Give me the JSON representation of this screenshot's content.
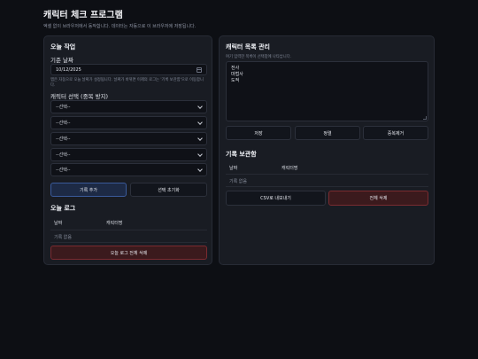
{
  "header": {
    "title": "캐릭터 체크 프로그램",
    "subtitle": "엑셀 없이 브라우저에서 동작합니다. 데이터는 자동으로 이 브라우저에 저장됩니다."
  },
  "today": {
    "section_title": "오늘 작업",
    "date_label": "기준 날짜",
    "date_value": "10/12/2025",
    "date_hint": "앱은 자동으로 오늘 날짜가 설정됩니다. 날짜가 바뀌면 이제의 로그는 '기록 보관함'으로 이동합니다.",
    "select_label": "캐릭터 선택 (중복 방지)",
    "selects": [
      "--선택--",
      "--선택--",
      "--선택--",
      "--선택--",
      "--선택--"
    ],
    "add_button": "기록 추가",
    "reset_button": "선택 초기화"
  },
  "log": {
    "section_title": "오늘 로그",
    "columns": [
      "날짜",
      "캐릭터명"
    ],
    "empty_text": "기록 없음",
    "clear_button": "오늘 로그 전체 삭제"
  },
  "characters": {
    "section_title": "캐릭터 목록 관리",
    "hint": "여기 입력한 목록이 선택창에 나타납니다.",
    "list_text": "전사\n마법사\n도적",
    "save_button": "저장",
    "sort_button": "정렬",
    "dedupe_button": "중복제거"
  },
  "archive": {
    "section_title": "기록 보관함",
    "columns": [
      "날짜",
      "캐릭터명"
    ],
    "empty_text": "기록 없음",
    "export_button": "CSV로 내보내기",
    "delete_all_button": "전체 삭제"
  }
}
